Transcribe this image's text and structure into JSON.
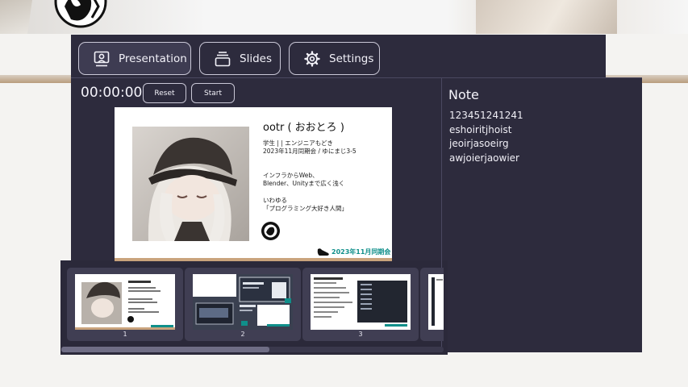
{
  "colors": {
    "panel_bg": "#2d2b3d",
    "tab_active_bg": "#3e3c52",
    "thumb_bg": "#403e53",
    "badge_teal": "#0f8f8a"
  },
  "tabs": [
    {
      "label": "Presentation",
      "icon": "person-board-icon",
      "active": true
    },
    {
      "label": "Slides",
      "icon": "slides-stack-icon",
      "active": false
    },
    {
      "label": "Settings",
      "icon": "gear-icon",
      "active": false
    }
  ],
  "timer": {
    "value": "00:00:00",
    "reset_label": "Reset",
    "start_label": "Start"
  },
  "slide": {
    "title": "ootr ( おおとろ )",
    "meta": [
      "学生 | | エンジニアもどき",
      "2023年11月同期会 / ゆにまじ3-5"
    ],
    "interests": [
      "インフラからWeb、",
      "Blender、Unityまで広く浅く"
    ],
    "catchphrase": [
      "いわゆる",
      "「プログラミング大好き人間」"
    ],
    "badge": "2023年11月同期会"
  },
  "note": {
    "title": "Note",
    "lines": [
      "123451241241",
      "eshoiritjhoist",
      "jeoirjasoeirg",
      "awjoierjaowier"
    ]
  },
  "thumbnails": [
    {
      "number": "1"
    },
    {
      "number": "2"
    },
    {
      "number": "3"
    },
    {
      "number": ""
    }
  ]
}
